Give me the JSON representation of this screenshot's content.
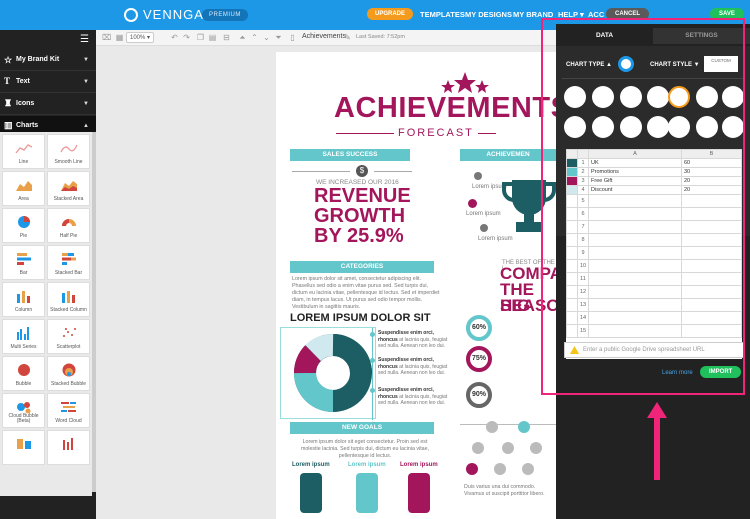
{
  "topbar": {
    "brand": "VENNGAGE",
    "premium": "PREMIUM",
    "upgrade": "UPGRADE",
    "links": [
      "TEMPLATES",
      "MY DESIGNS",
      "MY BRAND",
      "HELP ▾",
      "ACC"
    ],
    "cancel": "CANCEL",
    "save": "SAVE"
  },
  "toolbar": {
    "zoom": "100% ▾",
    "doc_title": "Achievements",
    "last_saved": "Last Saved: 7:52pm"
  },
  "sidebar": {
    "brand_kit": "My Brand Kit",
    "text": "Text",
    "icons": "Icons",
    "charts": "Charts",
    "chart_types": [
      "Line",
      "Smooth Line",
      "Area",
      "Stacked Area",
      "Pie",
      "Half Pie",
      "Bar",
      "Stacked Bar",
      "Column",
      "Stacked Column",
      "Multi Series",
      "Scatterplot",
      "Bubble",
      "Stacked Bubble",
      "Cloud Bubble (Beta)",
      "Word Cloud",
      "",
      ""
    ]
  },
  "infographic": {
    "title": "ACHIEVEMENTS",
    "subtitle": "FORECAST",
    "sales": "SALES SUCCESS",
    "achieve": "ACHIEVEMEN",
    "lorem_ipsum": "Lorem ipsum",
    "increase": "WE INCREASED OUR 2016",
    "revenue": [
      "REVENUE",
      "GROWTH",
      "BY 25.9%"
    ],
    "categories": "CATEGORIES",
    "cat_text": "Lorem ipsum dolor sit amet, consectetur adipiscing elit. Phasellus sed odio a enim vitae purus sed. Sed turpis dui, dictum eu lacinia vitae, pellentesque id lectus. Sed et imperdiet diam, in tempus lacus. Ut purus sed odio tempor mollis. Vestibulum in sagittis mauris.",
    "best": "THE BEST OF THE L",
    "compa": [
      "COMPA",
      "THE HIG",
      "SEASON"
    ],
    "lorem_dolor": "LOREM IPSUM DOLOR SIT",
    "bullets": [
      {
        "bold": "Suspendisse enim orci, rhoncus",
        "rest": "at lacinia quis, feugiat sed nulla. Aenean non leo dui."
      },
      {
        "bold": "Suspendisse enim orci, rhoncus",
        "rest": "at lacinia quis, feugiat sed nulla. Aenean non leo dui."
      },
      {
        "bold": "Suspendisse enim orci, rhoncus",
        "rest": "at lacinia quis, feugiat sed nulla. Aenean non leo dui."
      }
    ],
    "percents": [
      "60%",
      "75%",
      "90%"
    ],
    "new_goals": "NEW GOALS",
    "goals_text": "Lorem ipsum dolor sit eget consectetur. Proin sed est molestie lacinia. Sed turpis dui, dictum eu lacinia vitae, pellentesque id lectus.",
    "goal_labels": [
      "Lorem ipsum",
      "Lorem ipsum",
      "Lorem ipsum"
    ],
    "dui_text": "Duis varius una dui commodo. Vivamus ut suscipit porttitor libero."
  },
  "panel": {
    "tab_data": "DATA",
    "tab_settings": "SETTINGS",
    "chart_type": "CHART TYPE ▲",
    "chart_style": "CHART STYLE ▼",
    "custom": "CUSTOM",
    "col_a": "A",
    "col_b": "B",
    "rows": [
      {
        "n": "1",
        "a": "UK",
        "b": "60"
      },
      {
        "n": "2",
        "a": "Promotions",
        "b": "30"
      },
      {
        "n": "3",
        "a": "Free Gift",
        "b": "20"
      },
      {
        "n": "4",
        "a": "Discount",
        "b": "20"
      }
    ],
    "row_numbers": [
      "5",
      "6",
      "7",
      "8",
      "9",
      "10",
      "11",
      "12",
      "13",
      "14",
      "15"
    ],
    "gdrive_placeholder": "Enter a public Google Drive spreadsheet URL",
    "learn_more": "Learn more",
    "import": "IMPORT"
  },
  "colors": {
    "brand_blue": "#1c98e6",
    "magenta": "#a3165c",
    "teal": "#62c6ca",
    "dark_teal": "#1c5e63",
    "highlight": "#f0257a",
    "green": "#20c05c"
  }
}
